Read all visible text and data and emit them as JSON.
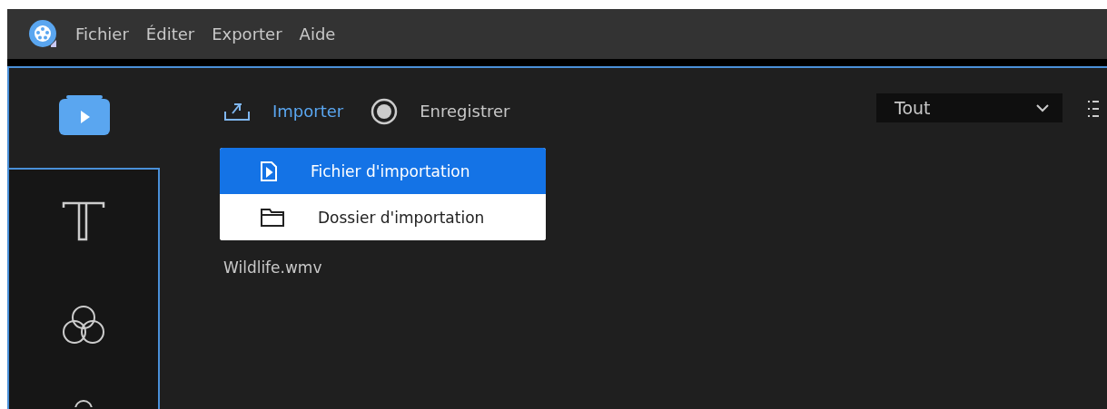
{
  "menu_bar": {
    "items": [
      "Fichier",
      "Éditer",
      "Exporter",
      "Aide"
    ]
  },
  "sidebar": {
    "tabs": [
      {
        "kind": "media",
        "selected": true
      },
      {
        "kind": "text",
        "selected": false
      },
      {
        "kind": "filter",
        "selected": false
      },
      {
        "kind": "circle",
        "selected": false
      }
    ]
  },
  "toolbar": {
    "buttons": [
      {
        "kind": "import",
        "label": "Importer",
        "selected": true
      },
      {
        "kind": "record",
        "label": "Enregistrer",
        "selected": false
      }
    ]
  },
  "import_menu": {
    "items": [
      {
        "kind": "file",
        "label": "Fichier d'importation",
        "selected": true
      },
      {
        "kind": "folder",
        "label": "Dossier d'importation",
        "selected": false
      }
    ]
  },
  "files": [
    "Wildlife.wmv"
  ],
  "filter_select": {
    "value": "Tout"
  }
}
